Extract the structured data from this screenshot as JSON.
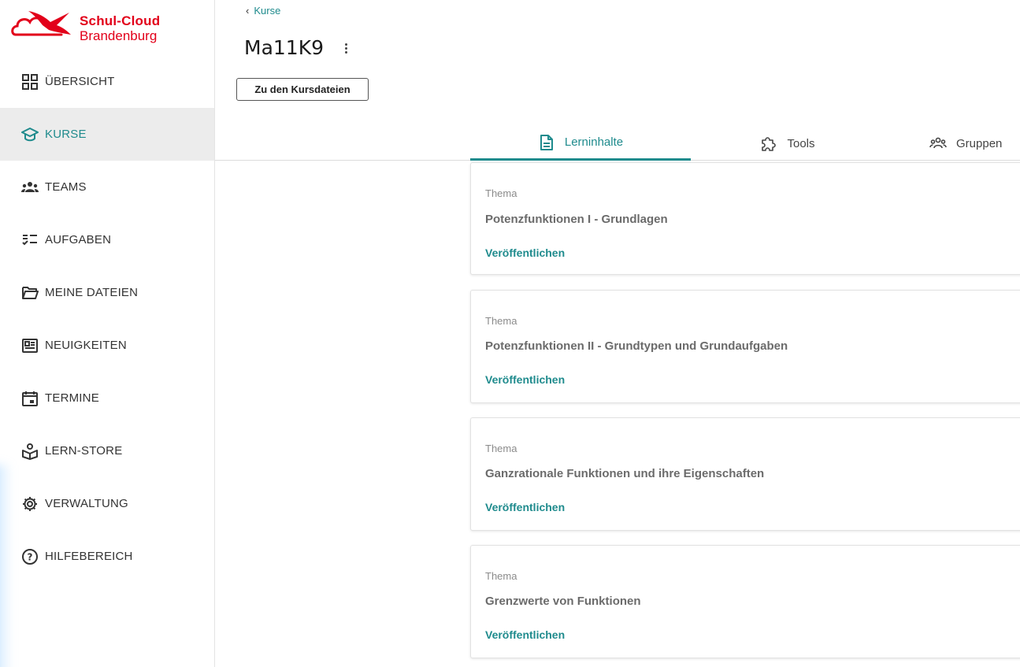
{
  "logo": {
    "line1": "Schul-Cloud",
    "line2": "Brandenburg"
  },
  "sidebar": {
    "items": [
      {
        "label": "ÜBERSICHT",
        "icon": "dashboard-grid-icon",
        "active": false
      },
      {
        "label": "KURSE",
        "icon": "graduation-cap-icon",
        "active": true
      },
      {
        "label": "TEAMS",
        "icon": "team-people-icon",
        "active": false
      },
      {
        "label": "AUFGABEN",
        "icon": "tasks-checklist-icon",
        "active": false
      },
      {
        "label": "MEINE DATEIEN",
        "icon": "folder-open-icon",
        "active": false
      },
      {
        "label": "NEUIGKEITEN",
        "icon": "newspaper-icon",
        "active": false
      },
      {
        "label": "TERMINE",
        "icon": "calendar-icon",
        "active": false
      },
      {
        "label": "LERN-STORE",
        "icon": "lern-store-icon",
        "active": false
      },
      {
        "label": "VERWALTUNG",
        "icon": "gear-icon",
        "active": false
      },
      {
        "label": "HILFEBEREICH",
        "icon": "help-circle-icon",
        "active": false
      }
    ]
  },
  "header": {
    "breadcrumb": "Kurse",
    "title": "Ma11K9",
    "files_button": "Zu den Kursdateien"
  },
  "tabs": [
    {
      "label": "Lerninhalte",
      "icon": "document-icon",
      "active": true
    },
    {
      "label": "Tools",
      "icon": "puzzle-icon",
      "active": false
    },
    {
      "label": "Gruppen",
      "icon": "group-people-icon",
      "active": false
    }
  ],
  "topics": [
    {
      "kind": "Thema",
      "title": "Potenzfunktionen I - Grundlagen",
      "action": "Veröffentlichen"
    },
    {
      "kind": "Thema",
      "title": "Potenzfunktionen II - Grundtypen und Grundaufgaben",
      "action": "Veröffentlichen"
    },
    {
      "kind": "Thema",
      "title": "Ganzrationale Funktionen und ihre Eigenschaften",
      "action": "Veröffentlichen"
    },
    {
      "kind": "Thema",
      "title": "Grenzwerte von Funktionen",
      "action": "Veröffentlichen"
    }
  ],
  "colors": {
    "brand_red": "#e2001a",
    "accent_teal": "#1f8b8d",
    "active_bg": "#ececec"
  }
}
